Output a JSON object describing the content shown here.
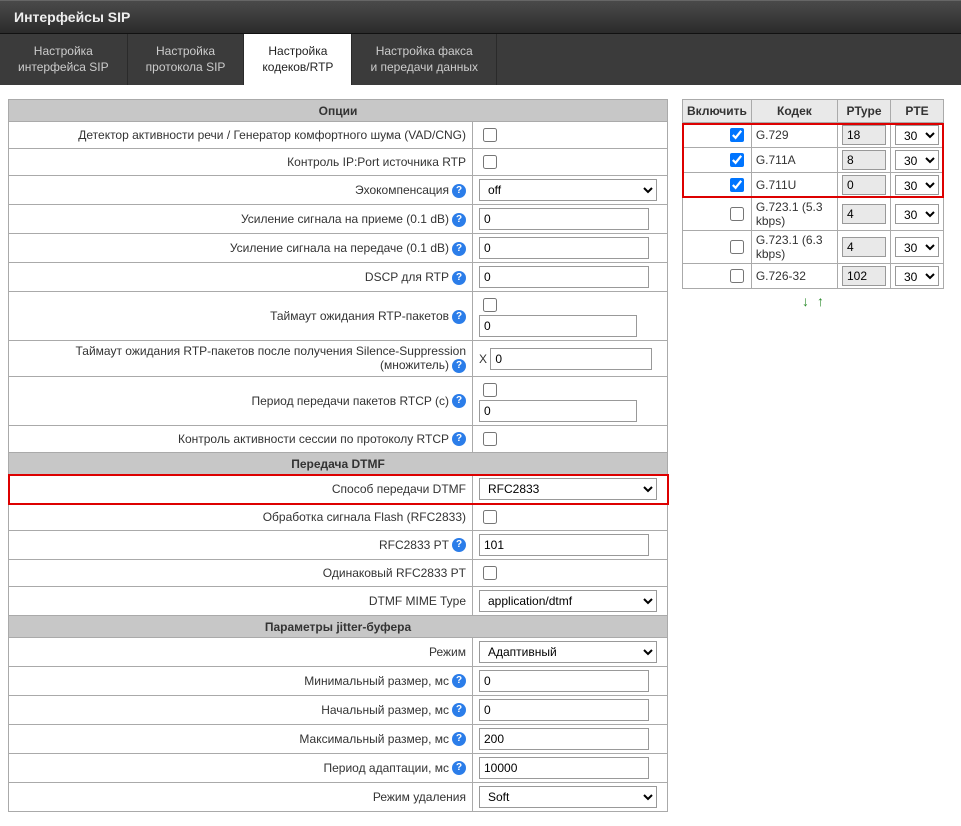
{
  "page_title": "Интерфейсы SIP",
  "tabs": [
    {
      "label": "Настройка\nинтерфейса SIP"
    },
    {
      "label": "Настройка\nпротокола SIP"
    },
    {
      "label": "Настройка\nкодеков/RTP"
    },
    {
      "label": "Настройка факса\nи передачи данных"
    }
  ],
  "active_tab": 2,
  "sections": {
    "options": "Опции",
    "dtmf": "Передача DTMF",
    "jitter": "Параметры jitter-буфера"
  },
  "labels": {
    "vad": "Детектор активности речи / Генератор комфортного шума (VAD/CNG)",
    "rtp_src": "Контроль IP:Port источника RTP",
    "echo": "Эхокомпенсация",
    "rx_gain": "Усиление сигнала на приеме (0.1 dB)",
    "tx_gain": "Усиление сигнала на передаче (0.1 dB)",
    "dscp": "DSCP для RTP",
    "rtp_timeout": "Таймаут ожидания RTP-пакетов",
    "ss_factor": "Таймаут ожидания RTP-пакетов после получения Silence-Suppression (множитель)",
    "rtcp_period": "Период передачи пакетов RTCP (с)",
    "rtcp_ctrl": "Контроль активности сессии по протоколу RTCP",
    "dtmf_mode": "Способ передачи DTMF",
    "flash": "Обработка сигнала Flash (RFC2833)",
    "rfc_pt": "RFC2833 PT",
    "same_pt": "Одинаковый RFC2833 PT",
    "mime": "DTMF MIME Type",
    "jb_mode": "Режим",
    "jb_min": "Минимальный размер, мс",
    "jb_init": "Начальный размер, мс",
    "jb_max": "Максимальный размер, мс",
    "jb_adapt": "Период адаптации, мс",
    "jb_del": "Режим удаления"
  },
  "values": {
    "echo": "off",
    "rx_gain": "0",
    "tx_gain": "0",
    "dscp": "0",
    "rtp_timeout": "0",
    "ss_factor_prefix": "X",
    "ss_factor": "0",
    "rtcp_period": "0",
    "dtmf_mode": "RFC2833",
    "rfc_pt": "101",
    "mime": "application/dtmf",
    "jb_mode": "Адаптивный",
    "jb_min": "0",
    "jb_init": "0",
    "jb_max": "200",
    "jb_adapt": "10000",
    "jb_del": "Soft"
  },
  "codec_table": {
    "headers": {
      "enable": "Включить",
      "codec": "Кодек",
      "ptype": "PType",
      "pte": "PTE"
    },
    "rows": [
      {
        "enabled": true,
        "name": "G.729",
        "ptype": "18",
        "pte": "30",
        "hl": true
      },
      {
        "enabled": true,
        "name": "G.711A",
        "ptype": "8",
        "pte": "30",
        "hl": true
      },
      {
        "enabled": true,
        "name": "G.711U",
        "ptype": "0",
        "pte": "30",
        "hl": true
      },
      {
        "enabled": false,
        "name": "G.723.1 (5.3 kbps)",
        "ptype": "4",
        "pte": "30",
        "hl": false
      },
      {
        "enabled": false,
        "name": "G.723.1 (6.3 kbps)",
        "ptype": "4",
        "pte": "30",
        "hl": false
      },
      {
        "enabled": false,
        "name": "G.726-32",
        "ptype": "102",
        "pte": "30",
        "hl": false
      }
    ]
  },
  "arrows": {
    "down": "↓",
    "up": "↑"
  }
}
